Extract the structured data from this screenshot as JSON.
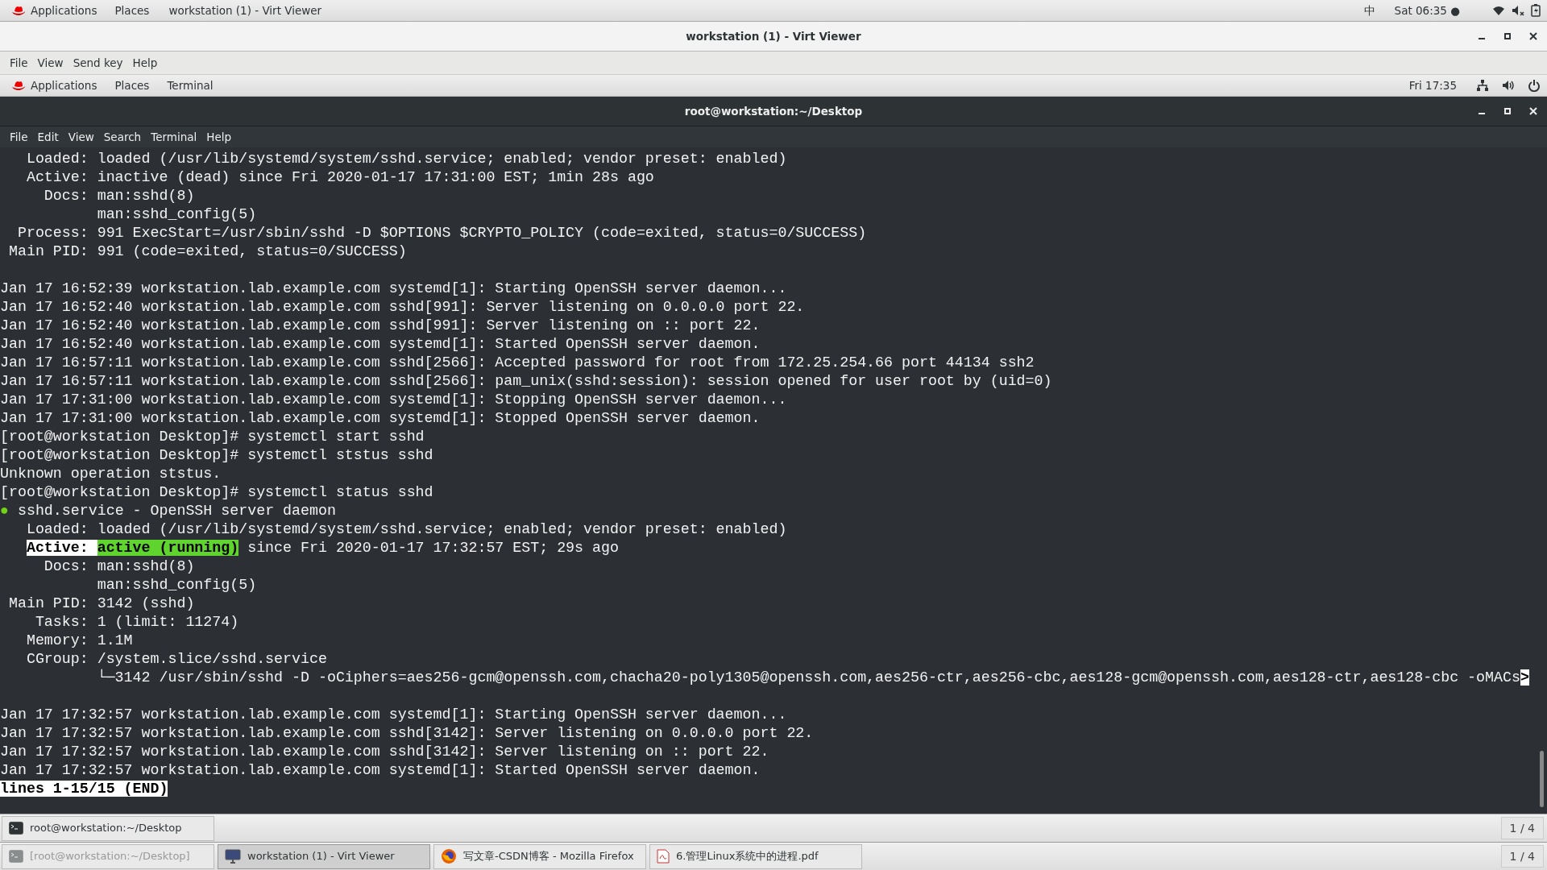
{
  "top_bar": {
    "menus": [
      "Applications",
      "Places"
    ],
    "window_title": "workstation (1) - Virt Viewer",
    "input_method": "中",
    "clock": "Sat 06:35 ●"
  },
  "viewer_window": {
    "title": "workstation (1) - Virt Viewer",
    "menu": [
      "File",
      "View",
      "Send key",
      "Help"
    ]
  },
  "guest_top_bar": {
    "menus": [
      "Applications",
      "Places",
      "Terminal"
    ],
    "clock": "Fri 17:35"
  },
  "terminal_window": {
    "title": "root@workstation:~/Desktop",
    "menu": [
      "File",
      "Edit",
      "View",
      "Search",
      "Terminal",
      "Help"
    ],
    "lines": [
      {
        "kind": "text",
        "text": "   Loaded: loaded (/usr/lib/systemd/system/sshd.service; enabled; vendor preset: enabled)"
      },
      {
        "kind": "text",
        "text": "   Active: inactive (dead) since Fri 2020-01-17 17:31:00 EST; 1min 28s ago"
      },
      {
        "kind": "text",
        "text": "     Docs: man:sshd(8)"
      },
      {
        "kind": "text",
        "text": "           man:sshd_config(5)"
      },
      {
        "kind": "text",
        "text": "  Process: 991 ExecStart=/usr/sbin/sshd -D $OPTIONS $CRYPTO_POLICY (code=exited, status=0/SUCCESS)"
      },
      {
        "kind": "text",
        "text": " Main PID: 991 (code=exited, status=0/SUCCESS)"
      },
      {
        "kind": "blank"
      },
      {
        "kind": "text",
        "text": "Jan 17 16:52:39 workstation.lab.example.com systemd[1]: Starting OpenSSH server daemon..."
      },
      {
        "kind": "text",
        "text": "Jan 17 16:52:40 workstation.lab.example.com sshd[991]: Server listening on 0.0.0.0 port 22."
      },
      {
        "kind": "text",
        "text": "Jan 17 16:52:40 workstation.lab.example.com sshd[991]: Server listening on :: port 22."
      },
      {
        "kind": "text",
        "text": "Jan 17 16:52:40 workstation.lab.example.com systemd[1]: Started OpenSSH server daemon."
      },
      {
        "kind": "text",
        "text": "Jan 17 16:57:11 workstation.lab.example.com sshd[2566]: Accepted password for root from 172.25.254.66 port 44134 ssh2"
      },
      {
        "kind": "text",
        "text": "Jan 17 16:57:11 workstation.lab.example.com sshd[2566]: pam_unix(sshd:session): session opened for user root by (uid=0)"
      },
      {
        "kind": "text",
        "text": "Jan 17 17:31:00 workstation.lab.example.com systemd[1]: Stopping OpenSSH server daemon..."
      },
      {
        "kind": "text",
        "text": "Jan 17 17:31:00 workstation.lab.example.com systemd[1]: Stopped OpenSSH server daemon."
      },
      {
        "kind": "text",
        "text": "[root@workstation Desktop]# systemctl start sshd"
      },
      {
        "kind": "text",
        "text": "[root@workstation Desktop]# systemctl ststus sshd"
      },
      {
        "kind": "text",
        "text": "Unknown operation ststus."
      },
      {
        "kind": "text",
        "text": "[root@workstation Desktop]# systemctl status sshd"
      },
      {
        "kind": "mixed",
        "segments": [
          {
            "kind": "dot",
            "text": "●"
          },
          {
            "kind": "plain",
            "text": " sshd.service - OpenSSH server daemon"
          }
        ]
      },
      {
        "kind": "text",
        "text": "   Loaded: loaded (/usr/lib/systemd/system/sshd.service; enabled; vendor preset: enabled)"
      },
      {
        "kind": "mixed",
        "indented": true,
        "segments": [
          {
            "kind": "inverse",
            "text": "Active: "
          },
          {
            "kind": "highlight",
            "text": "active (running)"
          },
          {
            "kind": "plain",
            "text": " since Fri 2020-01-17 17:32:57 EST; 29s ago"
          }
        ]
      },
      {
        "kind": "text",
        "text": "     Docs: man:sshd(8)"
      },
      {
        "kind": "text",
        "text": "           man:sshd_config(5)"
      },
      {
        "kind": "text",
        "text": " Main PID: 3142 (sshd)"
      },
      {
        "kind": "text",
        "text": "    Tasks: 1 (limit: 11274)"
      },
      {
        "kind": "text",
        "text": "   Memory: 1.1M"
      },
      {
        "kind": "text",
        "text": "   CGroup: /system.slice/sshd.service"
      },
      {
        "kind": "mixed",
        "segments": [
          {
            "kind": "plain",
            "text": "           └─3142 /usr/sbin/sshd -D -oCiphers=aes256-gcm@openssh.com,chacha20-poly1305@openssh.com,aes256-ctr,aes256-cbc,aes128-gcm@openssh.com,aes128-ctr,aes128-cbc -oMACs"
          },
          {
            "kind": "inverse",
            "text": ">"
          }
        ]
      },
      {
        "kind": "blank"
      },
      {
        "kind": "text",
        "text": "Jan 17 17:32:57 workstation.lab.example.com systemd[1]: Starting OpenSSH server daemon..."
      },
      {
        "kind": "text",
        "text": "Jan 17 17:32:57 workstation.lab.example.com sshd[3142]: Server listening on 0.0.0.0 port 22."
      },
      {
        "kind": "text",
        "text": "Jan 17 17:32:57 workstation.lab.example.com sshd[3142]: Server listening on :: port 22."
      },
      {
        "kind": "text",
        "text": "Jan 17 17:32:57 workstation.lab.example.com systemd[1]: Started OpenSSH server daemon."
      },
      {
        "kind": "mixed",
        "segments": [
          {
            "kind": "inverse",
            "text": "lines 1-15/15 (END)"
          }
        ]
      }
    ]
  },
  "guest_taskbar": {
    "items": [
      {
        "label": "root@workstation:~/Desktop",
        "kind": "terminal",
        "selected": false,
        "minimized": false
      }
    ],
    "workspace": "1 / 4"
  },
  "host_taskbar": {
    "items": [
      {
        "label": "[root@workstation:~/Desktop]",
        "kind": "terminal",
        "selected": false,
        "minimized": true
      },
      {
        "label": "workstation (1) - Virt Viewer",
        "kind": "viewer",
        "selected": true,
        "minimized": false
      },
      {
        "label": "写文章-CSDN博客 - Mozilla Firefox",
        "kind": "browser",
        "selected": false,
        "minimized": false
      },
      {
        "label": "6.管理Linux系统中的进程.pdf",
        "kind": "document",
        "selected": false,
        "minimized": false
      }
    ],
    "workspace": "1 / 4"
  }
}
